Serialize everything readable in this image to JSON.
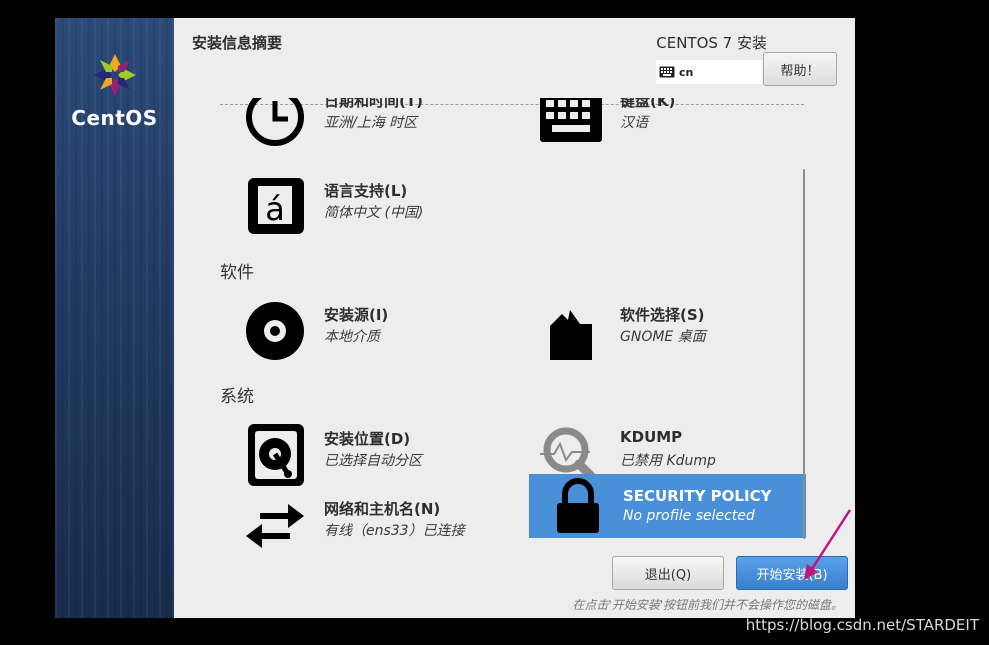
{
  "brand": {
    "logo_text": "CentOS"
  },
  "header": {
    "title": "安装信息摘要",
    "product": "CENTOS 7 安装",
    "keyboard_layout": "cn",
    "help_label": "帮助！"
  },
  "sections": {
    "localization_hidden": "",
    "software": "软件",
    "system": "系统"
  },
  "spokes": {
    "datetime": {
      "title": "日期和时间(T)",
      "status": "亚洲/上海 时区"
    },
    "keyboard": {
      "title": "键盘(K)",
      "status": "汉语"
    },
    "language": {
      "title": "语言支持(L)",
      "status": "简体中文 (中国)"
    },
    "source": {
      "title": "安装源(I)",
      "status": "本地介质"
    },
    "software": {
      "title": "软件选择(S)",
      "status": "GNOME 桌面"
    },
    "destination": {
      "title": "安装位置(D)",
      "status": "已选择自动分区"
    },
    "kdump": {
      "title": "KDUMP",
      "status": "已禁用 Kdump"
    },
    "network": {
      "title": "网络和主机名(N)",
      "status": "有线（ens33）已连接"
    },
    "security": {
      "title": "SECURITY POLICY",
      "status": "No profile selected"
    }
  },
  "footer": {
    "quit_label": "退出(Q)",
    "begin_label": "开始安装(B)",
    "note": "在点击'开始安装'按钮前我们并不会操作您的磁盘。"
  },
  "watermark": "https://blog.csdn.net/STARDEIT",
  "colors": {
    "accent": "#4a90d9",
    "sidebar": "#223a62",
    "annotation_arrow": "#c0147f"
  }
}
